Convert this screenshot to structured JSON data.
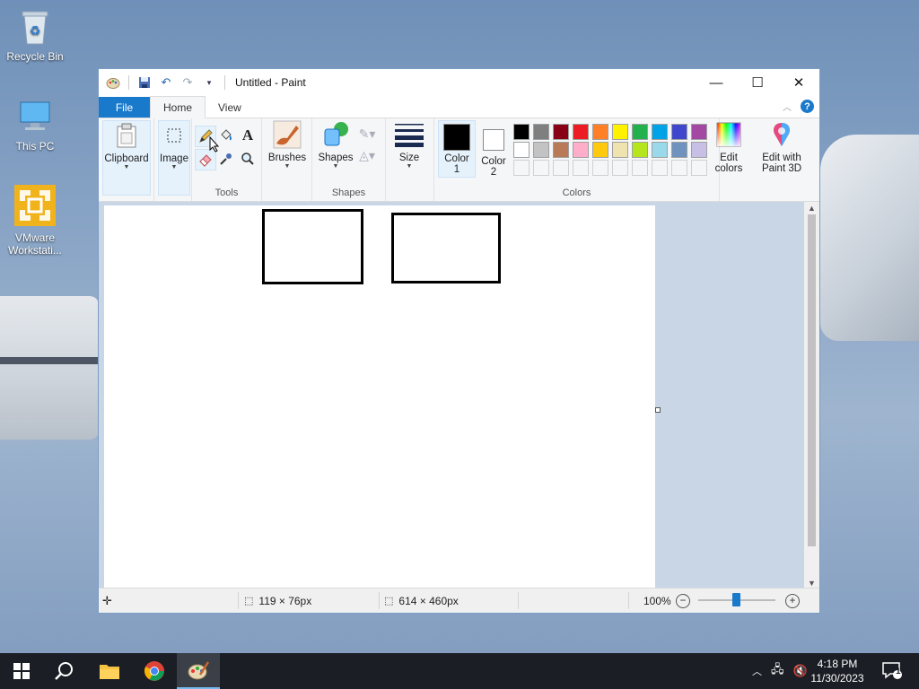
{
  "desktop": {
    "icons": [
      {
        "label": "Recycle Bin"
      },
      {
        "label": "This PC"
      },
      {
        "label": "VMware Workstati..."
      }
    ]
  },
  "window": {
    "title": "Untitled - Paint",
    "tabs": {
      "file": "File",
      "home": "Home",
      "view": "View"
    },
    "help": "?"
  },
  "ribbon": {
    "clipboard": "Clipboard",
    "image": "Image",
    "tools_label": "Tools",
    "brushes": "Brushes",
    "shapes": "Shapes",
    "shapes_group_label": "Shapes",
    "size": "Size",
    "color1": "Color\n1",
    "color1_line1": "Color",
    "color1_line2": "1",
    "color2_line1": "Color",
    "color2_line2": "2",
    "colors_label": "Colors",
    "edit_colors_line1": "Edit",
    "edit_colors_line2": "colors",
    "edit_paint3d_line1": "Edit with",
    "edit_paint3d_line2": "Paint 3D",
    "palette_row1": [
      "#000000",
      "#7f7f7f",
      "#880015",
      "#ed1c24",
      "#ff7f27",
      "#fff200",
      "#22b14c",
      "#00a2e8",
      "#3f48cc",
      "#a349a4"
    ],
    "palette_row2": [
      "#ffffff",
      "#c3c3c3",
      "#b97a57",
      "#ffaec9",
      "#ffc90e",
      "#efe4b0",
      "#b5e61d",
      "#99d9ea",
      "#7092be",
      "#c8bfe7"
    ],
    "color1_value": "#000000",
    "color2_value": "#ffffff"
  },
  "status": {
    "selection_size": "119 × 76px",
    "canvas_size": "614 × 460px",
    "zoom": "100%"
  },
  "taskbar": {
    "time": "4:18 PM",
    "date": "11/30/2023",
    "notifications": "1"
  }
}
